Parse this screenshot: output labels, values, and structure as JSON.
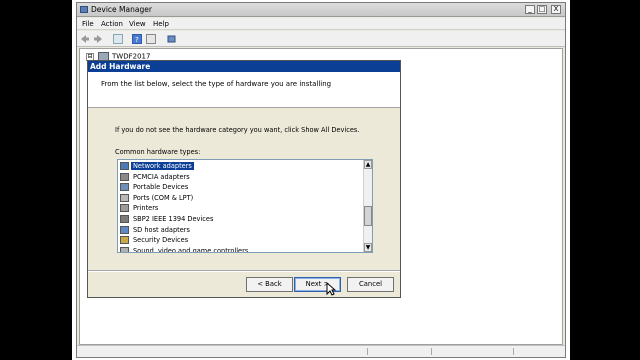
{
  "window": {
    "title": "Device Manager",
    "min": "_",
    "max": "□",
    "close": "X"
  },
  "menu": [
    "File",
    "Action",
    "View",
    "Help"
  ],
  "tree": {
    "root": "TWDF2017",
    "expander": "⊟"
  },
  "dialog": {
    "title": "Add Hardware",
    "heading": "From the list below, select the type of hardware you are installing",
    "info": "If you do not see the hardware category you want, click Show All Devices.",
    "list_label": "Common hardware types:",
    "items": [
      {
        "label": "Network adapters",
        "selected": true,
        "icon": "network-adapter-icon",
        "color": "#4a7ab8"
      },
      {
        "label": "PCMCIA adapters",
        "selected": false,
        "icon": "pcmcia-icon",
        "color": "#8a8a8a"
      },
      {
        "label": "Portable Devices",
        "selected": false,
        "icon": "portable-device-icon",
        "color": "#6d8fb8"
      },
      {
        "label": "Ports (COM & LPT)",
        "selected": false,
        "icon": "port-icon",
        "color": "#b9b9b9"
      },
      {
        "label": "Printers",
        "selected": false,
        "icon": "printer-icon",
        "color": "#9c9c9c"
      },
      {
        "label": "SBP2 IEEE 1394 Devices",
        "selected": false,
        "icon": "ieee1394-icon",
        "color": "#7c7c7c"
      },
      {
        "label": "SD host adapters",
        "selected": false,
        "icon": "sd-adapter-icon",
        "color": "#5f8ac7"
      },
      {
        "label": "Security Devices",
        "selected": false,
        "icon": "security-device-icon",
        "color": "#c9a94a"
      },
      {
        "label": "Sound, video and game controllers",
        "selected": false,
        "icon": "sound-icon",
        "color": "#b0b0b0"
      }
    ],
    "buttons": {
      "back": "< Back",
      "next": "Next >",
      "cancel": "Cancel"
    },
    "scroll_up": "▲",
    "scroll_down": "▼"
  },
  "colors": {
    "title_bar": "#0b3f96",
    "selection": "#0b3f96",
    "dialog_bg": "#ece9d8"
  }
}
